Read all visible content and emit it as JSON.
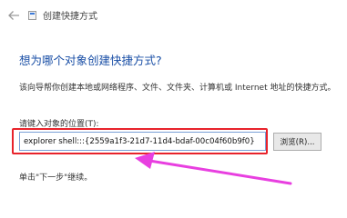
{
  "window": {
    "title": "创建快捷方式",
    "back_icon": "arrow-left-icon",
    "app_icon": "shortcut-icon"
  },
  "main": {
    "heading": "想为哪个对象创建快捷方式?",
    "description": "该向导帮你创建本地或网络程序、文件、文件夹、计算机或 Internet 地址的快捷方式。",
    "location_label": "请键入对象的位置(T):",
    "location_value": "explorer shell:::{2559a1f3-21d7-11d4-bdaf-00c04f60b9f0}",
    "browse_label": "浏览(R)...",
    "hint": "单击\"下一步\"继续。"
  },
  "annotation": {
    "highlight_color": "#e8232b",
    "arrow_color": "#e83fe0"
  }
}
